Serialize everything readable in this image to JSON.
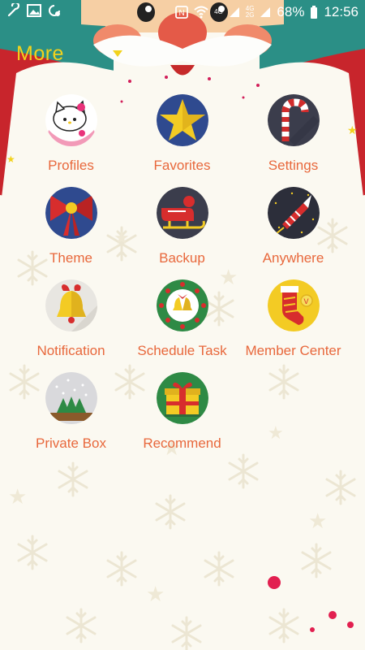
{
  "status_bar": {
    "battery": "68%",
    "time": "12:56",
    "network_top": "4G",
    "network_bottom": "2G",
    "network_type_left": "4G"
  },
  "header": {
    "title": "More"
  },
  "grid": {
    "items": [
      {
        "label": "Profiles",
        "icon": "hello-kitty-icon"
      },
      {
        "label": "Favorites",
        "icon": "star-icon"
      },
      {
        "label": "Settings",
        "icon": "candy-cane-icon"
      },
      {
        "label": "Theme",
        "icon": "ribbon-bow-icon"
      },
      {
        "label": "Backup",
        "icon": "sleigh-icon"
      },
      {
        "label": "Anywhere",
        "icon": "firework-rocket-icon"
      },
      {
        "label": "Notification",
        "icon": "bell-icon"
      },
      {
        "label": "Schedule Task",
        "icon": "wreath-icon"
      },
      {
        "label": "Member Center",
        "icon": "stocking-icon"
      },
      {
        "label": "Private Box",
        "icon": "snow-globe-icon"
      },
      {
        "label": "Recommend",
        "icon": "gift-box-icon"
      }
    ]
  },
  "colors": {
    "teal": "#2b8f86",
    "red": "#c8252c",
    "label": "#e8683c",
    "title": "#f2d21c"
  }
}
